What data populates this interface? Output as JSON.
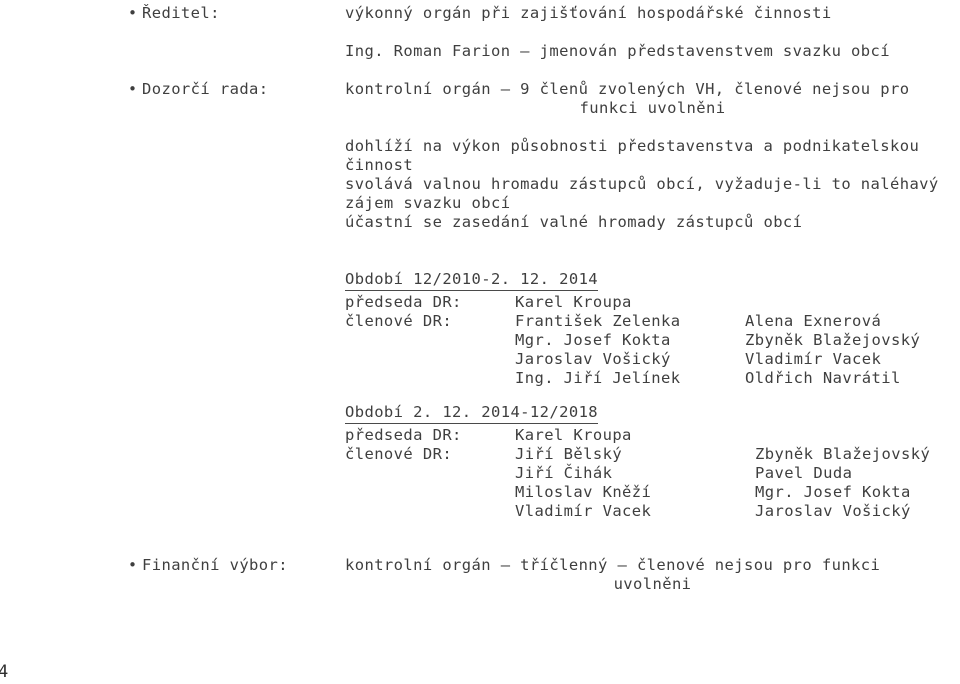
{
  "page": {
    "number": "4"
  },
  "sections": [
    {
      "id": "reditel",
      "bullet": "•",
      "label": "Ředitel:",
      "lines": [
        {
          "text": "výkonný orgán při zajišťování hospodářské činnosti",
          "align": "left"
        },
        {
          "text": "Ing. Roman Farion – jmenován představenstvem svazku obcí",
          "align": "left"
        }
      ]
    },
    {
      "id": "dozorci-rada",
      "bullet": "•",
      "label": "Dozorčí rada:",
      "lines": [
        {
          "text": "kontrolní orgán – 9 členů zvolených VH, členové nejsou pro",
          "align": "left"
        },
        {
          "text": "funkci uvolněni",
          "align": "center"
        },
        {
          "text": "dohlíží na výkon působnosti představenstva a podnikatelskou",
          "align": "left"
        },
        {
          "text": "činnost",
          "align": "left"
        },
        {
          "text": "svolává valnou hromadu zástupců obcí, vyžaduje-li to naléhavý",
          "align": "left"
        },
        {
          "text": "zájem svazku obcí",
          "align": "left"
        },
        {
          "text": "účastní se zasedání valné hromady zástupců obcí",
          "align": "left"
        }
      ]
    },
    {
      "id": "financni-vybor",
      "bullet": "•",
      "label": "Finanční výbor:",
      "lines": [
        {
          "text": "kontrolní orgán – tříčlenný – členové nejsou pro funkci",
          "align": "left"
        },
        {
          "text": "uvolněni",
          "align": "center"
        }
      ]
    }
  ],
  "periods": [
    {
      "id": "period-1",
      "title": "Období 12/2010-2. 12. 2014",
      "chair_label": "předseda DR:",
      "chair_name": "Karel Kroupa",
      "members_label": "členové DR:",
      "members": [
        {
          "left": "František Zelenka",
          "right": "Alena Exnerová"
        },
        {
          "left": "Mgr. Josef Kokta",
          "right": "Zbyněk Blažejovský"
        },
        {
          "left": "Jaroslav Vošický",
          "right": "Vladimír Vacek"
        },
        {
          "left": "Ing. Jiří Jelínek",
          "right": "Oldřich Navrátil"
        }
      ]
    },
    {
      "id": "period-2",
      "title": "Období 2. 12. 2014-12/2018",
      "chair_label": "předseda DR:",
      "chair_name": "Karel Kroupa",
      "members_label": "členové DR:",
      "members": [
        {
          "left": "Jiří Bělský",
          "right": "Zbyněk Blažejovský"
        },
        {
          "left": "Jiří Čihák",
          "right": "Pavel Duda"
        },
        {
          "left": "Miloslav Kněží",
          "right": "Mgr. Josef Kokta"
        },
        {
          "left": "Vladimír Vacek",
          "right": "Jaroslav Vošický"
        }
      ]
    }
  ],
  "colors": {
    "text": "#3f3f3f",
    "rule": "#4a4a4a",
    "background": "#ffffff"
  }
}
